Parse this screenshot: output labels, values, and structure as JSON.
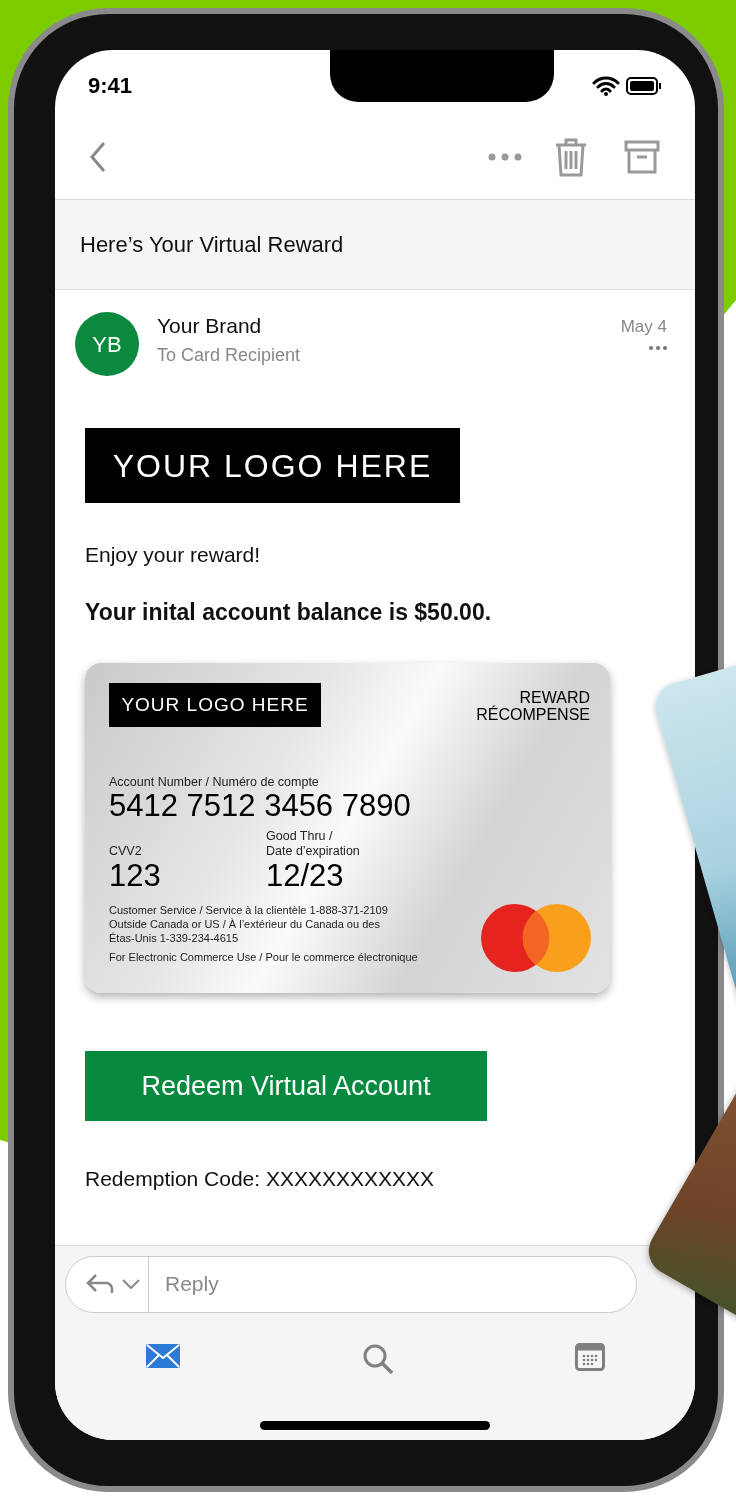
{
  "status_bar": {
    "time": "9:41"
  },
  "subject": "Here’s Your Virtual Reward",
  "sender": {
    "initials": "YB",
    "name": "Your Brand",
    "recipient": "To Card Recipient",
    "date": "May 4"
  },
  "body": {
    "logo_text": "YOUR LOGO HERE",
    "greeting": "Enjoy your reward!",
    "balance": "Your inital account balance is $50.00.",
    "card": {
      "logo_text": "YOUR LOGO HERE",
      "title_lines": [
        "REWARD",
        "RÉCOMPENSE"
      ],
      "account_label": "Account Number / Numéro de compte",
      "account_number": "5412 7512 3456 7890",
      "cvv_label": "CVV2",
      "cvv": "123",
      "expiry_label_lines": [
        "Good Thru /",
        "Date d’expiration"
      ],
      "expiry": "12/23",
      "service_lines": [
        "Customer Service / Service à la clientèle 1-888-371-2109",
        "Outside Canada or US / À l’extérieur du Canada ou des",
        "Étas-Unis 1-339-234-4615"
      ],
      "ecommerce_note": "For Electronic Commerce Use / Pour le commerce électronique"
    },
    "button": "Redeem Virtual Account",
    "redemption_code": "Redemption Code: XXXXXXXXXXXX"
  },
  "reply": {
    "placeholder": "Reply"
  },
  "tab_bar": [
    {
      "kind": "mail",
      "selected": true
    },
    {
      "kind": "search",
      "selected": false
    },
    {
      "kind": "calendar",
      "selected": false
    }
  ]
}
